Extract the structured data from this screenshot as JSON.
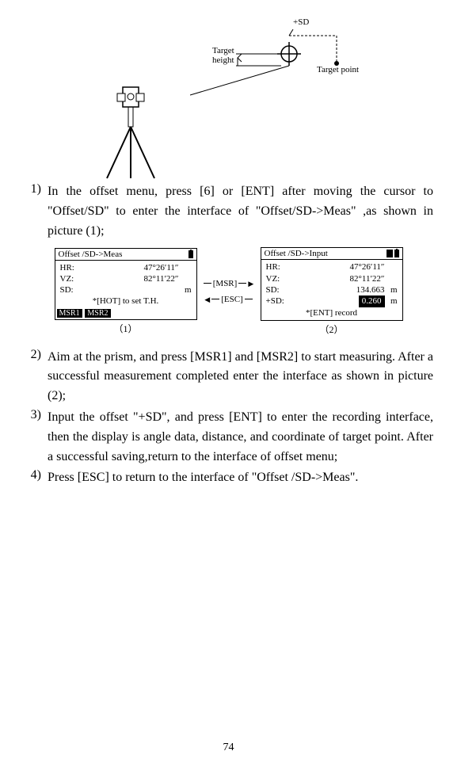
{
  "diagram": {
    "target_height_label": "Target\nheight",
    "plus_sd_label": "+SD",
    "target_point_label": "Target point"
  },
  "instructions": [
    {
      "num": "1)",
      "text": "In the offset menu, press [6] or [ENT] after moving the cursor to \"Offset/SD\" to enter the interface of \"Offset/SD->Meas\" ,as shown in picture (1);"
    },
    {
      "num": "2)",
      "text": "Aim at the prism, and press [MSR1] and [MSR2] to start measuring. After a successful measurement completed enter the interface as shown in picture (2);"
    },
    {
      "num": "3)",
      "text": "Input the offset \"+SD\", and press [ENT] to enter the recording interface, then the display is angle data, distance, and coordinate of target point. After a successful saving,return to the interface of offset menu;"
    },
    {
      "num": "4)",
      "text": "Press [ESC] to return to the interface of \"Offset /SD->Meas\"."
    }
  ],
  "screen1": {
    "title": "Offset /SD->Meas",
    "rows": {
      "hr_label": "HR:",
      "hr_value": "47°26′11″",
      "vz_label": "VZ:",
      "vz_value": "82°11′22″",
      "sd_label": "SD:",
      "sd_value": "",
      "sd_unit": "m"
    },
    "hint": "*[HOT] to set T.H.",
    "buttons": [
      "MSR1",
      "MSR2"
    ],
    "caption": "（1）"
  },
  "arrows": {
    "msr": "[MSR]",
    "esc": "[ESC]"
  },
  "screen2": {
    "title": "Offset /SD->Input",
    "rows": {
      "hr_label": "HR:",
      "hr_value": "47°26′11″",
      "vz_label": "VZ:",
      "vz_value": "82°11′22″",
      "sd_label": "SD:",
      "sd_value": "134.663",
      "sd_unit": "m",
      "psd_label": "+SD:",
      "psd_value": "0.260",
      "psd_unit": "m"
    },
    "hint": "*[ENT] record",
    "caption": "（2）"
  },
  "page_number": "74"
}
